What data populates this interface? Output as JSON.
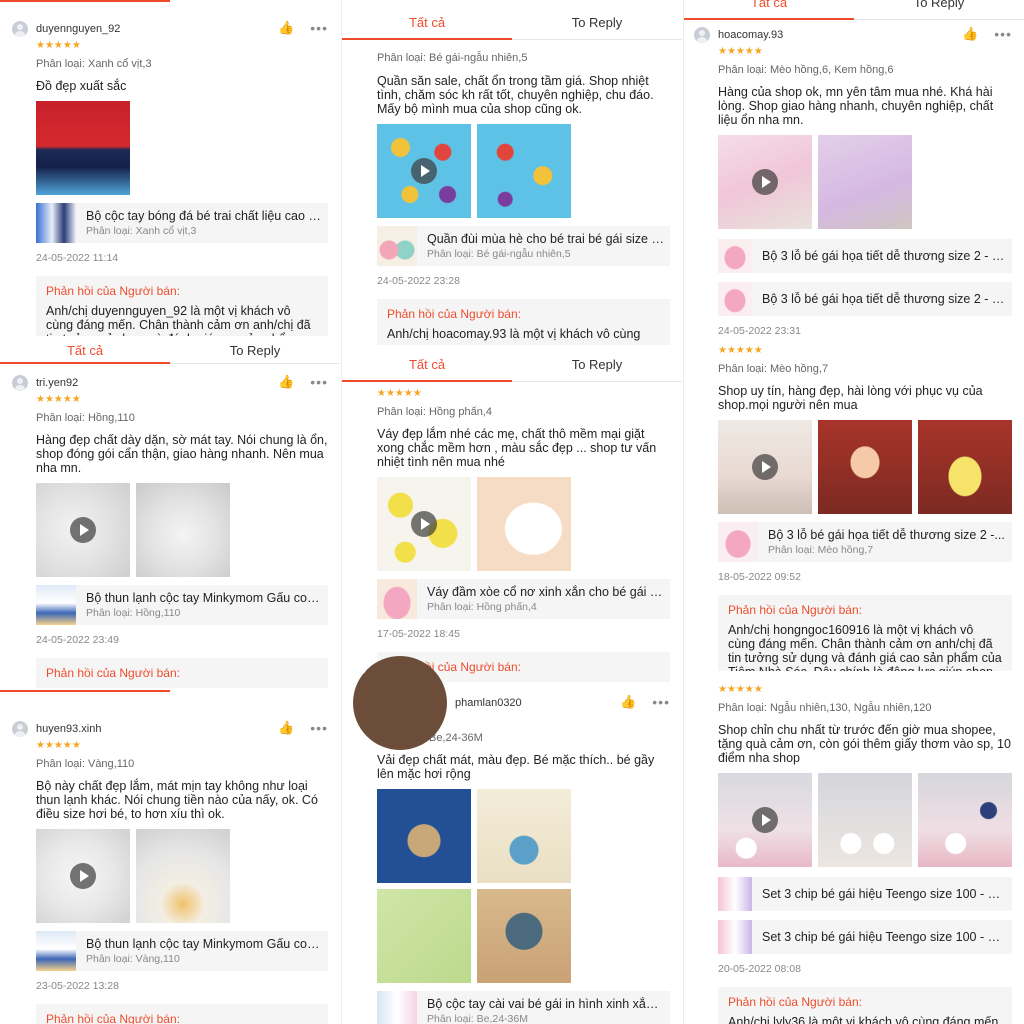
{
  "tabs": {
    "all": "Tất cả",
    "to_reply": "To Reply"
  },
  "colors": {
    "accent": "#ee4d2d",
    "stars": "#f5a623"
  },
  "stars": "★★★★★",
  "reply_title": "Phản hồi của Người bán:",
  "left": {
    "r1": {
      "user": "duyennguyen_92",
      "variant": "Phân loại: Xanh cổ vịt,3",
      "text": "Đồ đẹp xuất sắc",
      "product_name": "Bộ cộc tay bóng đá bé trai chất liệu cao c...",
      "product_variant": "Phân loại: Xanh cổ vịt,3",
      "date": "24-05-2022 11:14",
      "reply": "Anh/chị duyennguyen_92 là một vị khách vô cùng đáng mến. Chân thành cảm ơn anh/chị đã tin tưởng sử dụng và đánh giá cao sản phẩm của Tiệm Nhà"
    },
    "r2": {
      "user": "tri.yen92",
      "variant": "Phân loại: Hồng,110",
      "text": "Hàng đẹp chất dày dặn, sờ mát tay. Nói chung là ổn, shop đóng gói cẩn thận, giao hàng nhanh. Nên mua nha mn.",
      "product_name": "Bộ thun lạnh cộc tay Minkymom Gấu con [...",
      "product_variant": "Phân loại: Hồng,110",
      "date": "24-05-2022 23:49"
    },
    "r3": {
      "user": "huyen93.xinh",
      "variant": "Phân loại: Vàng,110",
      "text": "Bộ này chất đẹp lắm, mát mịn tay không như loại thun lạnh khác. Nói chung tiền nào của nấy, ok. Có điều size hơi bé, to hơn xíu thì ok.",
      "product_name": "Bộ thun lạnh cộc tay Minkymom Gấu con [...",
      "product_variant": "Phân loại: Vàng,110",
      "date": "23-05-2022 13:28"
    }
  },
  "mid": {
    "r1": {
      "variant": "Phân loại: Bé gái-ngẫu nhiên,5",
      "text": "Quần săn sale, chất ổn trong tầm giá. Shop nhiệt tình, chăm sóc kh rất tốt, chuyên nghiệp, chu đáo. Mấy bộ mình mua của shop cũng ok.",
      "product_name": "Quần đùi mùa hè cho bé trai bé gái size 1...",
      "product_variant": "Phân loại: Bé gái-ngẫu nhiên,5",
      "date": "24-05-2022 23:28",
      "reply": "Anh/chị hoacomay.93 là một vị khách vô cùng"
    },
    "r2": {
      "variant": "Phân loại: Hồng phấn,4",
      "text": "Váy đẹp lắm nhé các mẹ, chất thô mềm mại giặt xong chắc mềm hơn , màu sắc đẹp ... shop tư vấn nhiệt tình nên mua nhé",
      "product_name": "Váy đầm xòe cổ nơ xinh xắn cho bé gái Th...",
      "product_variant": "Phân loại: Hồng phấn,4",
      "date": "17-05-2022 18:45"
    },
    "r3": {
      "user": "phamlan0320",
      "variant": "Phân loại: Be,24-36M",
      "text": "Vải đẹp chất mát, màu đẹp. Bé mặc thích.. bé gầy lên mặc hơi rộng",
      "product_name": "Bộ cộc tay cài vai bé gái in hình xinh xắn h...",
      "product_variant": "Phân loại: Be,24-36M"
    }
  },
  "right": {
    "r1": {
      "user": "hoacomay.93",
      "variant": "Phân loại: Mèo hồng,6, Kem hồng,6",
      "text": "Hàng của shop ok, mn yên tâm mua nhé. Khá hài lòng. Shop giao hàng nhanh, chuyên nghiệp, chất liệu ổn nha mn.",
      "product_name": "Bộ 3 lỗ bé gái họa tiết dễ thương size 2 - 7 t...",
      "date": "24-05-2022 23:31"
    },
    "r2": {
      "variant": "Phân loại: Mèo hồng,7",
      "text": "Shop uy tín, hàng đẹp, hài lòng với phục vụ của shop.mọi người nên mua",
      "product_name": "Bộ 3 lỗ bé gái họa tiết dễ thương size 2 -...",
      "product_variant": "Phân loại: Mèo hồng,7",
      "date": "18-05-2022 09:52",
      "reply": "Anh/chị hongngoc160916 là một vị khách vô cùng đáng mến. Chân thành cảm ơn anh/chị đã tin tưởng sử dụng và đánh giá cao sản phẩm của Tiệm Nhà Sóc. Đây chính là động lực giúp shop cố gắng hoàn thiện"
    },
    "r3": {
      "variant": "Phân loại: Ngẫu nhiên,130, Ngẫu nhiên,120",
      "text": "Shop chỉn chu nhất từ trước đến giờ mua shopee, tặng quà cảm ơn, còn gói thêm giấy thơm vào sp, 10 điểm nha shop",
      "product_name": "Set 3 chip bé gái hiệu Teengo size 100 - 15...",
      "date": "20-05-2022 08:08",
      "reply": "Anh/chị lyly36 là một vị khách vô cùng đáng mến."
    }
  }
}
